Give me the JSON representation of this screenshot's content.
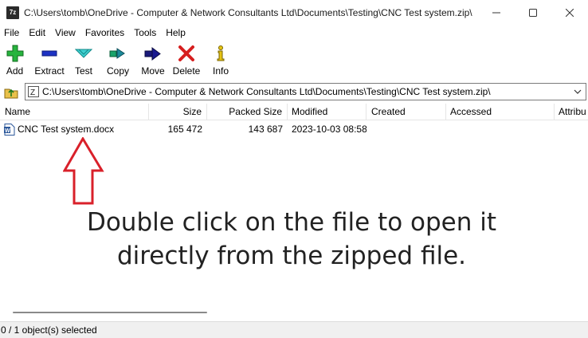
{
  "window": {
    "title": "C:\\Users\\tomb\\OneDrive - Computer & Network Consultants Ltd\\Documents\\Testing\\CNC Test system.zip\\",
    "app_icon_text": "7z"
  },
  "menu": [
    "File",
    "Edit",
    "View",
    "Favorites",
    "Tools",
    "Help"
  ],
  "toolbar": [
    {
      "label": "Add",
      "icon": "plus-icon"
    },
    {
      "label": "Extract",
      "icon": "minus-icon"
    },
    {
      "label": "Test",
      "icon": "check-chevron-icon"
    },
    {
      "label": "Copy",
      "icon": "copy-arrow-icon"
    },
    {
      "label": "Move",
      "icon": "move-arrow-icon"
    },
    {
      "label": "Delete",
      "icon": "delete-x-icon"
    },
    {
      "label": "Info",
      "icon": "info-icon"
    }
  ],
  "address": {
    "path": "C:\\Users\\tomb\\OneDrive - Computer & Network Consultants Ltd\\Documents\\Testing\\CNC Test system.zip\\"
  },
  "columns": {
    "name": "Name",
    "size": "Size",
    "packed": "Packed Size",
    "modified": "Modified",
    "created": "Created",
    "accessed": "Accessed",
    "attributes": "Attribu"
  },
  "files": [
    {
      "name": "CNC Test system.docx",
      "size": "165 472",
      "packed": "143 687",
      "modified": "2023-10-03 08:58"
    }
  ],
  "annotation": {
    "line1": "Double click on the file to open it",
    "line2": "directly from the zipped file.",
    "arrow_color": "#d9202a"
  },
  "status": {
    "selection": "0 / 1 object(s) selected"
  }
}
